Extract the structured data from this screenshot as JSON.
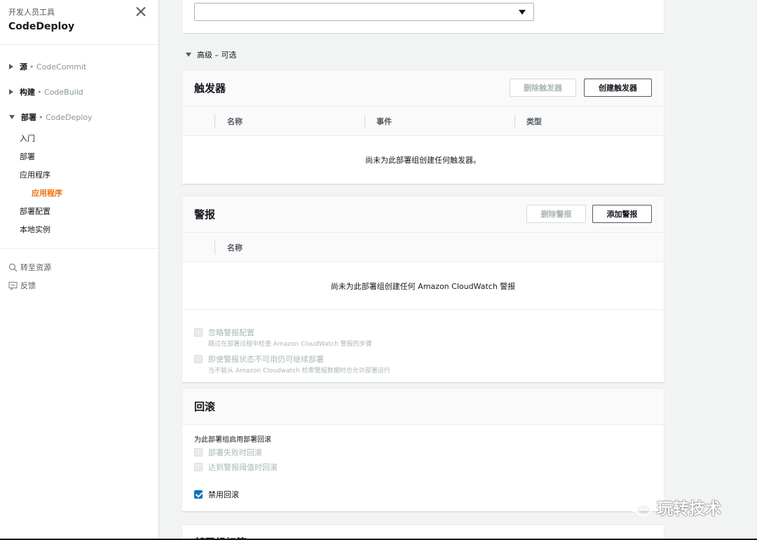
{
  "sidebar": {
    "subtitle": "开发人员工具",
    "title": "CodeDeploy",
    "sections": [
      {
        "name": "源",
        "service": "• CodeCommit"
      },
      {
        "name": "构建",
        "service": "• CodeBuild"
      },
      {
        "name": "部署",
        "service": "• CodeDeploy"
      }
    ],
    "items": [
      "入门",
      "部署",
      "应用程序",
      "应用程序",
      "部署配置",
      "本地实例"
    ],
    "links": [
      "转至资源",
      "反馈"
    ]
  },
  "advanced_toggle": "高级 – 可选",
  "triggers": {
    "title": "触发器",
    "delete_label": "删除触发器",
    "create_label": "创建触发器",
    "columns": [
      "名称",
      "事件",
      "类型"
    ],
    "empty_text": "尚未为此部署组创建任何触发器。"
  },
  "alarms": {
    "title": "警报",
    "delete_label": "删除警报",
    "add_label": "添加警报",
    "columns": [
      "名称"
    ],
    "empty_text": "尚未为此部署组创建任何 Amazon CloudWatch 警报",
    "options": [
      {
        "label": "忽略警报配置",
        "desc": "跳过在部署过程中检查 Amazon CloudWatch 警报的步骤"
      },
      {
        "label": "即使警报状态不可用仍可继续部署",
        "desc": "当不能从 Amazon Cloudwatch 检索警报数据时也允许部署运行"
      }
    ]
  },
  "rollback": {
    "title": "回滚",
    "note": "为此部署组启用部署回滚",
    "options": [
      "部署失败时回滚",
      "达到警报阈值时回滚"
    ],
    "disable_label": "禁用回滚",
    "disable_checked": true
  },
  "next_panel_title": "部署组标签",
  "watermark": "玩转技术",
  "colors": {
    "accent": "#ec7211",
    "link": "#0073bb"
  }
}
